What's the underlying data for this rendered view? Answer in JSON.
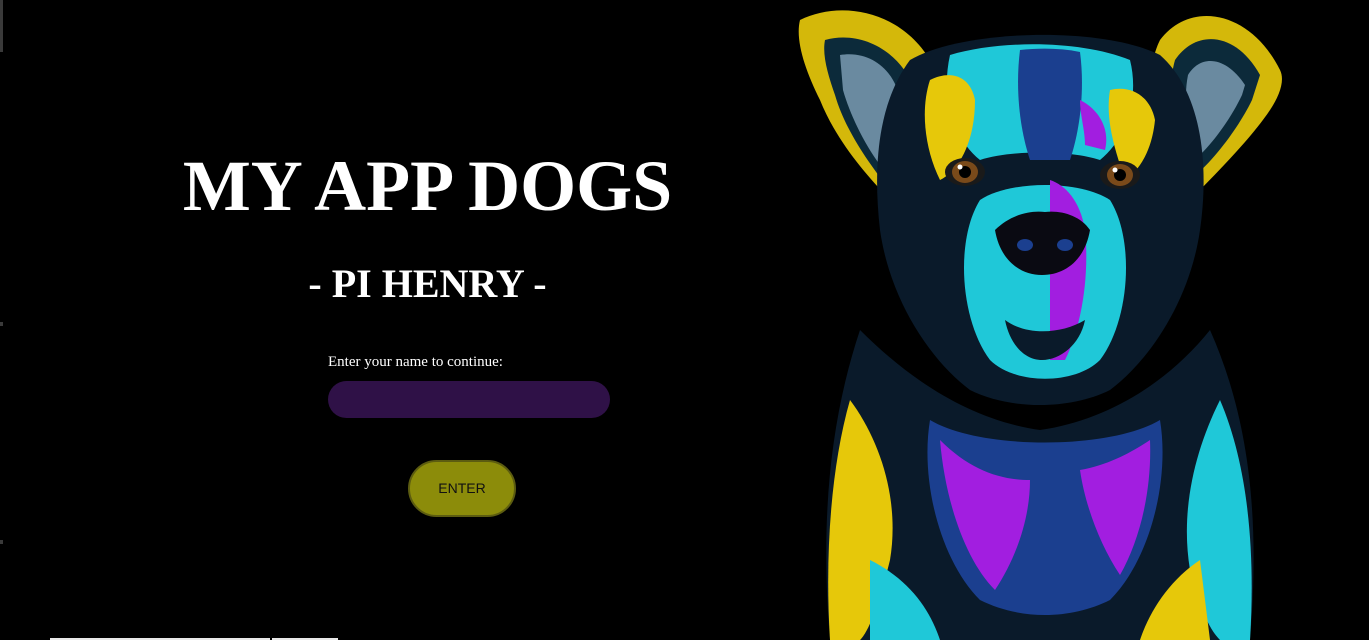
{
  "header": {
    "title": "MY APP DOGS",
    "subtitle": "- PI HENRY -"
  },
  "form": {
    "label": "Enter your name to continue:",
    "name_value": "",
    "name_placeholder": "",
    "enter_label": "ENTER"
  },
  "illustration": {
    "subject": "dog-portrait",
    "colors": {
      "yellow": "#e6c80a",
      "cyan": "#1fc8d8",
      "purple": "#a21ee0",
      "blue": "#1b3f8f",
      "brown_eye": "#7a4a1a"
    }
  },
  "colors": {
    "background": "#000000",
    "text": "#ffffff",
    "input_background": "#2f1147",
    "button_background": "#8c8c0a"
  }
}
